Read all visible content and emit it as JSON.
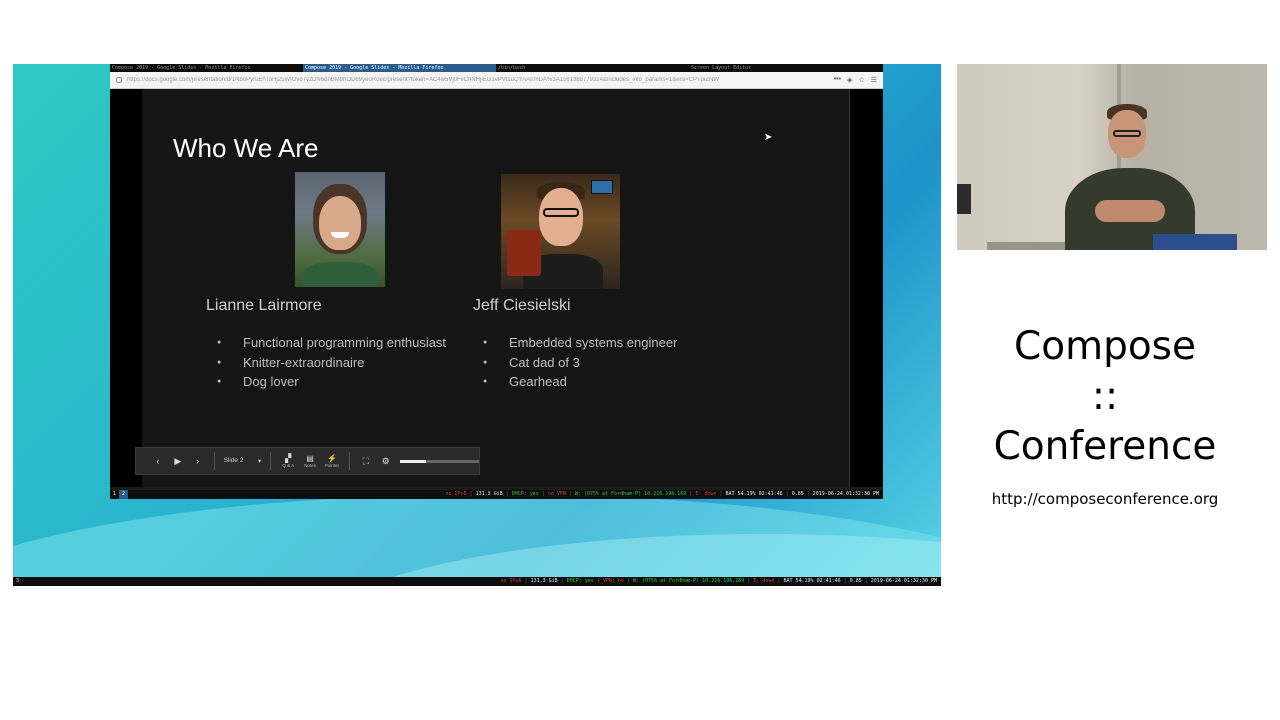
{
  "browser": {
    "wm_tabs": [
      {
        "label": "Compose 2019 - Google Slides - Mozilla Firefox",
        "active": false
      },
      {
        "label": "Compose 2019 - Google Slides - Mozilla Firefox",
        "active": true
      },
      {
        "label": "/bin/bash",
        "active": false
      },
      {
        "label": "Screen Layout Editor",
        "active": false
      }
    ],
    "url": "https://docs.google.com/presentation/d/1NboPyruEhToHj25WIOvo7vzDN6dnBM8hOD69yeoRoec/present?token=AC4w5Vj0FvChNHjiEG1vPVt1uQYAAnmDA%3A1561388779324&includes_info_params=1&eisi=CPTpiZNW"
  },
  "slide": {
    "title": "Who We Are",
    "people": [
      {
        "name": "Lianne Lairmore",
        "bullets": [
          "Functional programming enthusiast",
          "Knitter-extraordinaire",
          "Dog lover"
        ]
      },
      {
        "name": "Jeff Ciesielski",
        "bullets": [
          "Embedded systems engineer",
          "Cat dad of 3",
          "Gearhead"
        ]
      }
    ]
  },
  "toolbar": {
    "slide_select": "Slide 2",
    "qa_label": "Q & A",
    "notes_label": "Notes",
    "pointer_label": "Pointer",
    "volume_fraction": 0.33
  },
  "statusbar_inner": {
    "workspaces": [
      "1",
      "2"
    ],
    "segments": [
      {
        "text": "no IPv6",
        "color": "red"
      },
      {
        "text": "131.3 GiB",
        "color": "white"
      },
      {
        "text": "DHCP: yes",
        "color": "green"
      },
      {
        "text": "no VPN",
        "color": "red"
      },
      {
        "text": "W: (075% at Fordham-P) 10.216.196.169",
        "color": "green"
      },
      {
        "text": "E: down",
        "color": "red"
      },
      {
        "text": "BAT 54.19% 02:41:46",
        "color": "white"
      },
      {
        "text": "0.85",
        "color": "white"
      },
      {
        "text": "2019-06-24 01:32:30 PM",
        "color": "white"
      }
    ]
  },
  "statusbar_outer": {
    "workspaces": [
      "3"
    ],
    "segments": [
      {
        "text": "no IPv6",
        "color": "red"
      },
      {
        "text": "131.3 GiB",
        "color": "white"
      },
      {
        "text": "DHCP: yes",
        "color": "green"
      },
      {
        "text": "VPN: no",
        "color": "red"
      },
      {
        "text": "W: (075% at Fordham-P) 10.216.196.169",
        "color": "green"
      },
      {
        "text": "E: down",
        "color": "red"
      },
      {
        "text": "BAT 54.19% 02:41:46",
        "color": "white"
      },
      {
        "text": "0.85",
        "color": "white"
      },
      {
        "text": "2019-06-24 01:32:30 PM",
        "color": "white"
      }
    ]
  },
  "branding": {
    "line1": "Compose",
    "line2": "::",
    "line3": "Conference",
    "url": "http://composeconference.org"
  },
  "colors": {
    "desktop_accent": "#29b3cf",
    "wm_active": "#2b5d8a",
    "slide_bg": "#151515"
  }
}
